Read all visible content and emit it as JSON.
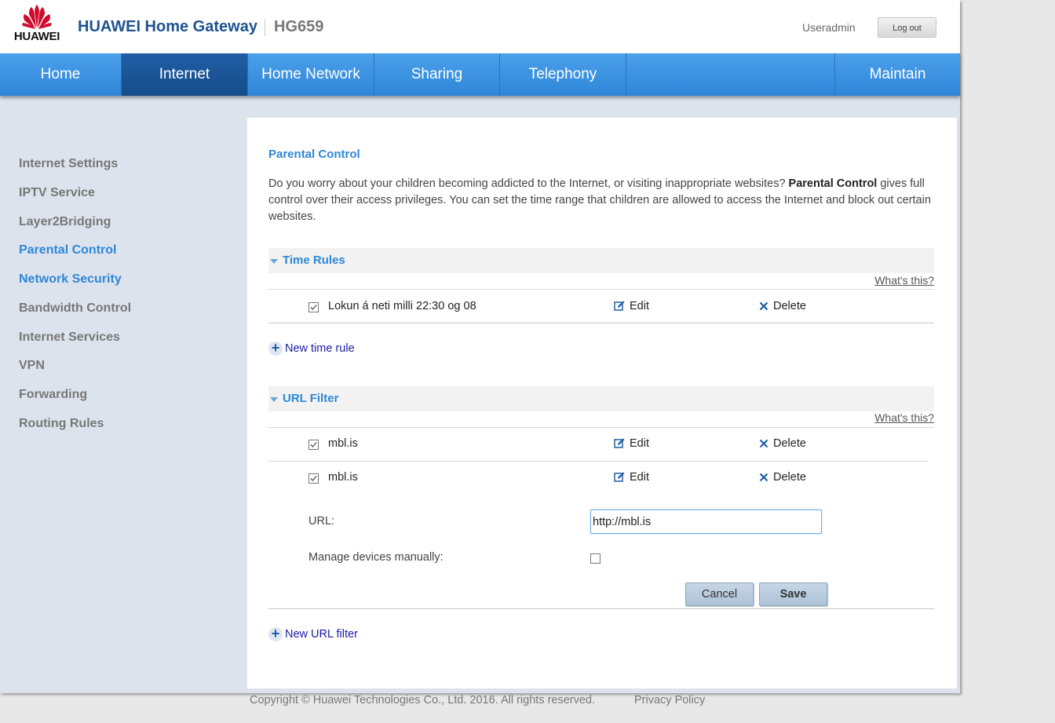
{
  "header": {
    "logo_text": "HUAWEI",
    "title": "HUAWEI Home Gateway",
    "model": "HG659",
    "user": "Useradmin",
    "logout_label": "Log out"
  },
  "nav": {
    "items": [
      "Home",
      "Internet",
      "Home Network",
      "Sharing",
      "Telephony",
      "Maintain"
    ],
    "active": "Internet"
  },
  "sidebar": {
    "items": [
      "Internet Settings",
      "IPTV Service",
      "Layer2Bridging",
      "Parental Control",
      "Network Security",
      "Bandwidth Control",
      "Internet Services",
      "VPN",
      "Forwarding",
      "Routing Rules"
    ],
    "active": "Parental Control"
  },
  "main": {
    "title": "Parental Control",
    "desc_before": "Do you worry about your children becoming addicted to the Internet, or visiting inappropriate websites? ",
    "desc_bold": "Parental Control",
    "desc_after": " gives full control over their access privileges. You can set the time range that children are allowed to access the Internet and block out certain websites.",
    "whats_this": "What's this?",
    "edit_label": "Edit",
    "delete_label": "Delete",
    "time_rules": {
      "title": "Time Rules",
      "rules": [
        {
          "label": "Lokun á neti milli 22:30 og 08",
          "checked": true
        }
      ],
      "new_label": "New time rule"
    },
    "url_filter": {
      "title": "URL Filter",
      "filters": [
        {
          "label": "mbl.is",
          "checked": true
        },
        {
          "label": "mbl.is",
          "checked": true
        }
      ],
      "form": {
        "url_label": "URL:",
        "url_value": "http://mbl.is",
        "manage_label": "Manage devices manually:",
        "manage_checked": false,
        "cancel_label": "Cancel",
        "save_label": "Save"
      },
      "new_label": "New URL filter"
    }
  },
  "footer": {
    "copyright": "Copyright © Huawei Technologies Co., Ltd. 2016. All rights reserved.",
    "privacy": "Privacy Policy"
  },
  "colors": {
    "accent": "#2e87d7",
    "nav_active": "#164c8a",
    "brand_red": "#cf0a2c"
  }
}
